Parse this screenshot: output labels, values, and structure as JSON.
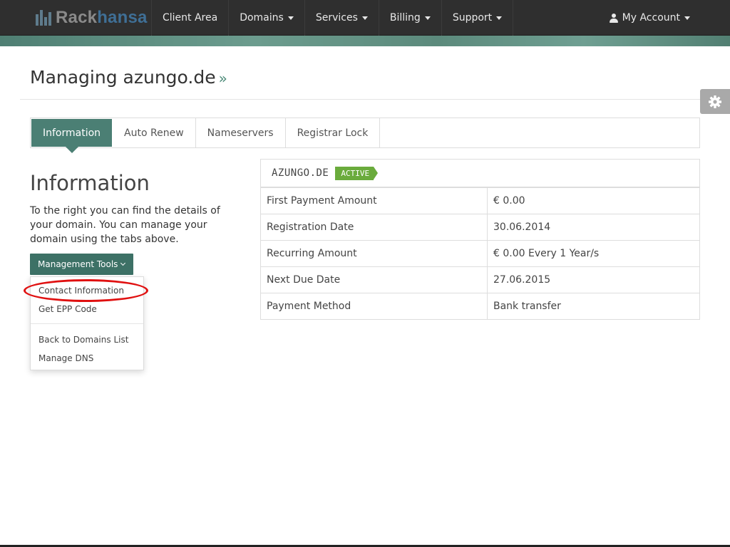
{
  "navbar": {
    "brand": {
      "part1": "Rack",
      "part2": "hansa"
    },
    "items": [
      {
        "label": "Client Area",
        "dropdown": false
      },
      {
        "label": "Domains",
        "dropdown": true
      },
      {
        "label": "Services",
        "dropdown": true
      },
      {
        "label": "Billing",
        "dropdown": true
      },
      {
        "label": "Support",
        "dropdown": true
      }
    ],
    "account_label": "My Account"
  },
  "page": {
    "title": "Managing azungo.de",
    "title_suffix": "»"
  },
  "tabs": [
    {
      "label": "Information",
      "active": true
    },
    {
      "label": "Auto Renew",
      "active": false
    },
    {
      "label": "Nameservers",
      "active": false
    },
    {
      "label": "Registrar Lock",
      "active": false
    }
  ],
  "info": {
    "heading": "Information",
    "text": "To the right you can find the details of your domain. You can manage your domain using the tabs above."
  },
  "management": {
    "button_label": "Management Tools",
    "menu": [
      "Contact Information",
      "Get EPP Code",
      "Back to Domains List",
      "Manage DNS"
    ]
  },
  "details": {
    "domain": "AZUNGO.DE",
    "status": "ACTIVE",
    "rows": [
      {
        "label": "First Payment Amount",
        "value": "€ 0.00"
      },
      {
        "label": "Registration Date",
        "value": "30.06.2014"
      },
      {
        "label": "Recurring Amount",
        "value": "€ 0.00 Every 1 Year/s"
      },
      {
        "label": "Next Due Date",
        "value": "27.06.2015"
      },
      {
        "label": "Payment Method",
        "value": "Bank transfer"
      }
    ]
  },
  "colors": {
    "navbar_bg": "#2f2f2f",
    "accent_green": "#4b7f74",
    "status_green": "#6aab3c",
    "highlight_red": "#e01010"
  },
  "icons": [
    "logo-bars-icon",
    "caret-down-icon",
    "user-icon",
    "gear-icon",
    "chevron-down-icon"
  ]
}
